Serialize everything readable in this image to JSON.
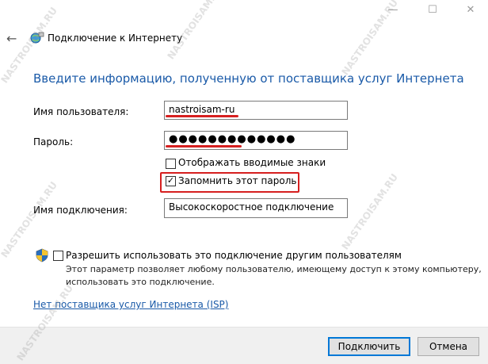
{
  "window": {
    "title": "Подключение к Интернету",
    "minimize_glyph": "—",
    "maximize_glyph": "☐",
    "close_glyph": "✕",
    "back_glyph": "←"
  },
  "heading": "Введите информацию, полученную от поставщика услуг Интернета",
  "form": {
    "username_label": "Имя пользователя:",
    "username_value": "nastroisam-ru",
    "password_label": "Пароль:",
    "password_value": "●●●●●●●●●●●●●",
    "show_chars_label": "Отображать вводимые знаки",
    "show_chars_checked": false,
    "remember_label": "Запомнить этот пароль",
    "remember_checked": true,
    "conn_name_label": "Имя подключения:",
    "conn_name_value": "Высокоскоростное подключение",
    "allow_others_label": "Разрешить использовать это подключение другим пользователям",
    "allow_others_checked": false,
    "allow_others_desc": "Этот параметр позволяет любому пользователю, имеющему доступ к этому компьютеру, использовать это подключение."
  },
  "isp_link": "Нет поставщика услуг Интернета (ISP)",
  "buttons": {
    "connect": "Подключить",
    "cancel": "Отмена"
  },
  "watermark": "NASTROISAM.RU",
  "colors": {
    "accent": "#1a5aa8",
    "highlight_red": "#d61f1f"
  }
}
